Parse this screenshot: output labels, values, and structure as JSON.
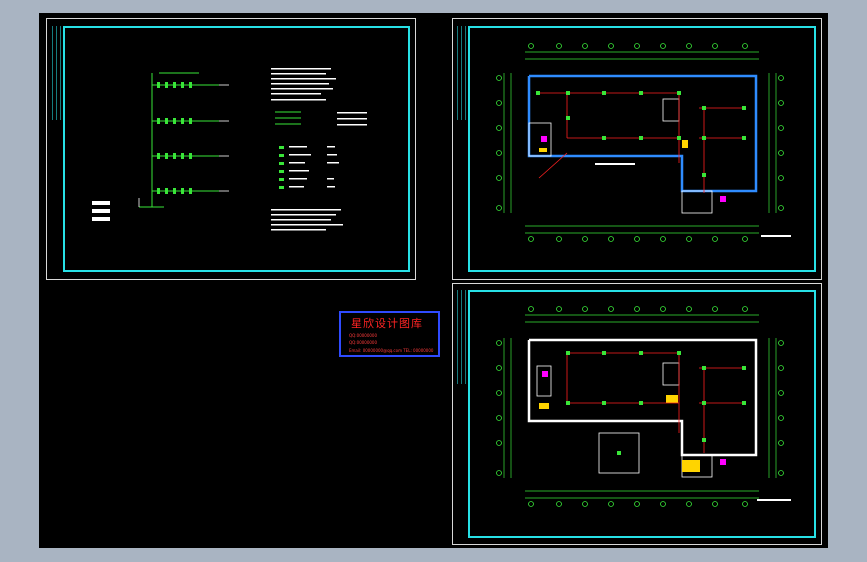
{
  "window": {
    "background_color": "#a9b4c2",
    "canvas_color": "#000000",
    "frame_color": "#27e0e6",
    "wire_color": "#ff2020",
    "grid_color": "#39e639"
  },
  "sheets": [
    {
      "name": "system-diagram-sheet"
    },
    {
      "name": "floor-plan-upper-sheet"
    },
    {
      "name": "floor-plan-lower-sheet"
    }
  ],
  "logo": {
    "title": "星欣设计图库",
    "lines": [
      "QQ:00000000",
      "QQ:00000000",
      "Email: 00000000@qq.com  TEL: 00000000"
    ],
    "border_color": "#2f4bff",
    "text_color": "#ff2424"
  }
}
